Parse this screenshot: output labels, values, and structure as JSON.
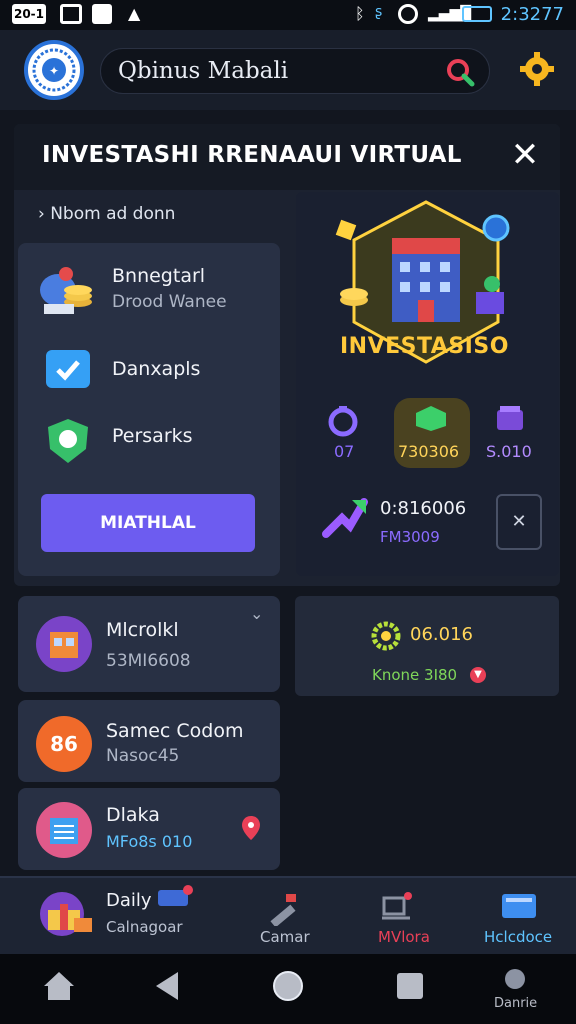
{
  "status_bar": {
    "time": "2:3277",
    "left_icons": [
      "sim-badge-icon",
      "image-icon",
      "notification-icon",
      "upload-icon"
    ],
    "left_badge_text": "20-1",
    "right_icons": [
      "bluetooth-icon",
      "wifi-call-icon",
      "shield-icon",
      "signal-icon",
      "battery-icon"
    ]
  },
  "header": {
    "search_text": "Qbinus Mabali"
  },
  "modal": {
    "title": "INVESTASHI RRENAAUI VIRTUAL",
    "close_label": "✕",
    "breadcrumb": "› Nbom ad donn",
    "menu_items": [
      {
        "title": "Bnnegtarl",
        "subtitle": "Drood Wanee"
      },
      {
        "title": "Danxapls",
        "subtitle": ""
      },
      {
        "title": "Persarks",
        "subtitle": ""
      }
    ],
    "withdraw_label": "MIATHLAL",
    "promo": {
      "title": "INVESTASISO",
      "stats": [
        {
          "value": "07",
          "color": "#8b6bff"
        },
        {
          "value": "730306",
          "color": "#ffd45a"
        },
        {
          "value": "S.010",
          "color": "#b38bff"
        }
      ],
      "reward_value": "0:816006",
      "reward_sub": "FM3009",
      "close_small": "✕"
    }
  },
  "list": [
    {
      "title": "Mlcrolkl",
      "subtitle": "53MI6608"
    },
    {
      "title": "Samec Codom",
      "subtitle": "Nasoc45"
    },
    {
      "title": "Dlaka",
      "subtitle": "MFo8s 010"
    }
  ],
  "side_card": {
    "value": "06.016",
    "sub": "Knone 3I80"
  },
  "bottom_nav": {
    "daily_title": "Daily",
    "daily_sub": "Calnagoar",
    "items": [
      {
        "label": "Camar"
      },
      {
        "label": "MVlora"
      },
      {
        "label": "Hclcdoce"
      }
    ]
  },
  "android_nav": {
    "extra_label": "Danrie"
  },
  "colors": {
    "accent": "#6d5cf0",
    "gold": "#ffc93b",
    "search_red": "#e94057",
    "link_blue": "#5fc4ff"
  }
}
